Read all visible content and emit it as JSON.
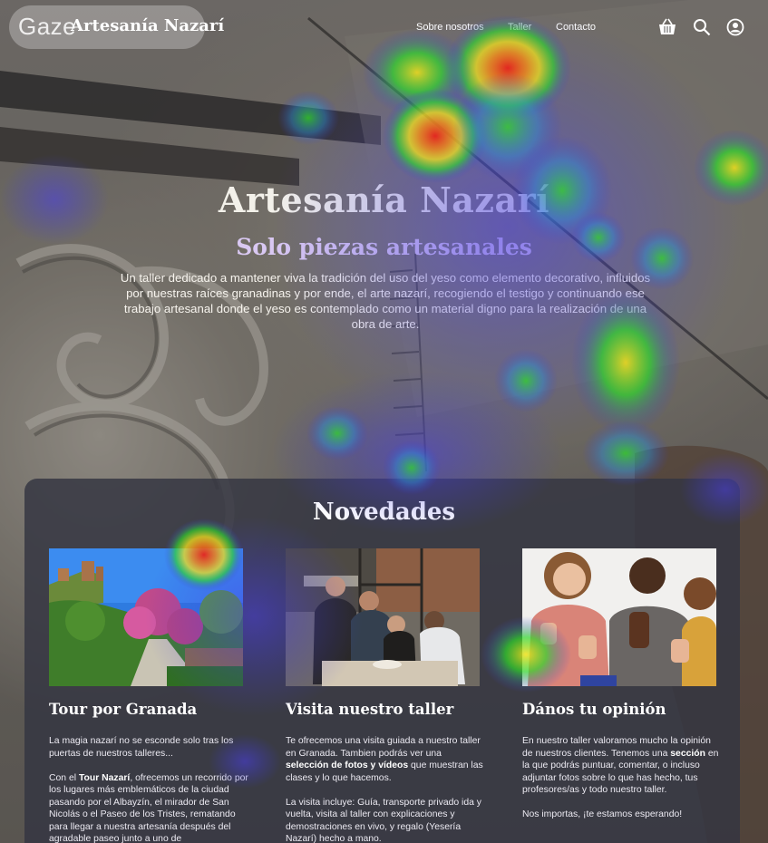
{
  "brand": {
    "watermark": "Gaze",
    "name": "Artesanía Nazarí"
  },
  "nav": {
    "items": [
      "Sobre nosotros",
      "Taller",
      "Contacto"
    ],
    "icons": [
      "basket-icon",
      "search-icon",
      "user-account-icon"
    ]
  },
  "hero": {
    "title": "Artesanía Nazarí",
    "subtitle": "Solo piezas artesanales",
    "description": "Un taller dedicado a mantener viva la tradición del uso del yeso como elemento decorativo, influidos por nuestras raíces granadinas y por ende, el arte nazarí, recogiendo el testigo y continuando ese trabajo artesanal donde el yeso es contemplado como un material digno para la realización de una obra de arte."
  },
  "news": {
    "title": "Novedades",
    "cards": [
      {
        "title": "Tour por Granada",
        "p1": "La magia nazarí no se esconde solo tras los puertas de nuestros talleres...",
        "p2_pre": "Con el ",
        "p2_bold": "Tour Nazarí",
        "p2_post": ", ofrecemos un recorrido por los lugares más emblemáticos de la ciudad pasando por el Albayzín, el mirador de San Nicolás o el Paseo de los Tristes, rematando para llegar a nuestra artesanía después del agradable paseo junto a uno de"
      },
      {
        "title": "Visita nuestro taller",
        "p1_pre": "Te ofrecemos una visita guiada a nuestro taller en Granada. Tambien podrás ver una ",
        "p1_bold": "selección de fotos y vídeos",
        "p1_post": " que muestran las clases y lo que hacemos.",
        "p2": "La visita incluye: Guía, transporte privado ida y vuelta, visita al taller con explicaciones y demostraciones en vivo, y regalo (Yesería Nazarí) hecho a mano."
      },
      {
        "title": "Dános tu opinión",
        "p1_pre": "En nuestro taller valoramos mucho la opinión de nuestros clientes. Tenemos una ",
        "p1_bold": "sección",
        "p1_post": " en la que podrás puntuar, comentar, o incluso adjuntar fotos sobre lo que has hecho, tus profesores/as y todo nuestro taller.",
        "p2": "Nos importas, ¡te estamos esperando!"
      }
    ]
  },
  "colors": {
    "panel": "#343642",
    "subtitle": "#d9c8f2",
    "heat_hot": "#e8241c",
    "heat_warm": "#f3e21a",
    "heat_mid": "#2fd92a",
    "heat_cool": "#3b3ae0"
  }
}
